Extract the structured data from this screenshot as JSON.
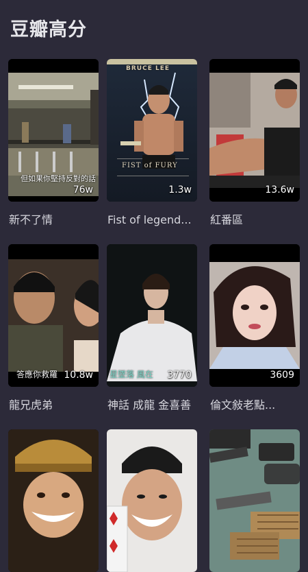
{
  "page": {
    "title": "豆瓣高分"
  },
  "items": [
    {
      "title": "新不了情",
      "count": "76w",
      "subtitle": "但如果你堅持反對的話"
    },
    {
      "title": "Fist of legend...",
      "count": "1.3w",
      "poster_text": "BRUCE LEE",
      "poster_sub": "FIST of FURY"
    },
    {
      "title": "紅番區",
      "count": "13.6w"
    },
    {
      "title": "龍兄虎弟",
      "count": "10.8w",
      "subtitle": "答應你救羅"
    },
    {
      "title": "神話 成龍 金喜善",
      "count": "3770",
      "subtitle": "星墜落 風在"
    },
    {
      "title": "倫文敍老點...",
      "count": "3609"
    },
    {
      "title": "",
      "count": ""
    },
    {
      "title": "",
      "count": ""
    },
    {
      "title": "",
      "count": ""
    }
  ]
}
